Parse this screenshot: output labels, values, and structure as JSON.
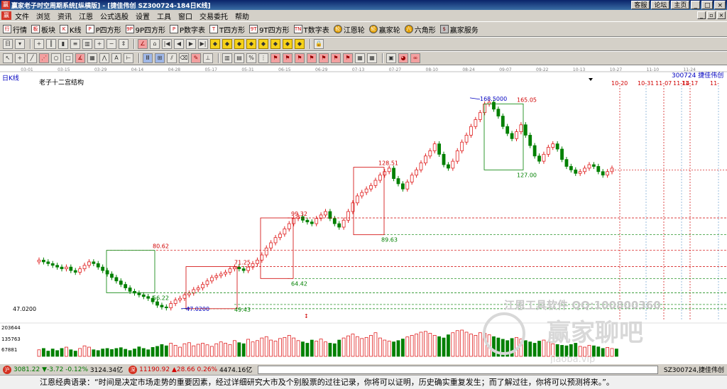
{
  "window": {
    "app_icon": "赢",
    "title": "赢家老子时空周期系统[纵横版] - [捷佳伟创  SZ300724-184日K线]",
    "top_links": [
      "客服",
      "论坛",
      "主页"
    ],
    "controls": [
      "minimize-icon",
      "maximize-icon",
      "close-icon"
    ]
  },
  "menu": {
    "items": [
      "文件",
      "浏览",
      "资讯",
      "江恩",
      "公式选股",
      "设置",
      "工具",
      "窗口",
      "交易委托",
      "帮助"
    ]
  },
  "toolbar1": {
    "tools": [
      {
        "icon": "行",
        "label": "行情"
      },
      {
        "icon": "板",
        "label": "板块"
      },
      {
        "icon": "K",
        "label": "K线"
      },
      {
        "icon": "P",
        "label": "P四方形"
      },
      {
        "icon": "9P",
        "label": "9P四方形"
      },
      {
        "icon": "P",
        "label": "P数字表"
      },
      {
        "icon": "T",
        "label": "T四方形"
      },
      {
        "icon": "9T",
        "label": "9T四方形"
      },
      {
        "icon": "TN",
        "label": "T数字表"
      },
      {
        "icon": "轮",
        "label": "江恩轮"
      },
      {
        "icon": "轮",
        "label": "赢家轮"
      },
      {
        "icon": "六",
        "label": "六角形"
      },
      {
        "icon": "$",
        "label": "赢家服务"
      }
    ]
  },
  "chart": {
    "period_label": "日K线",
    "indicator_label": "老子十二宫结构",
    "stock_label": "300724 捷佳伟创",
    "watermark_line1": "江恩工具软件  QQ:100800360",
    "watermark_line2": "赢家聊吧",
    "watermark_line3": "Jiaoba.vip",
    "colors": {
      "up": "#e02020",
      "down": "#008000",
      "grid": "#d00000",
      "box_green": "#008000",
      "box_red": "#e02020"
    }
  },
  "chart_data": {
    "type": "candlestick",
    "symbol": "SZ300724",
    "name": "捷佳伟创",
    "x_dates": [
      "03-01",
      "03-15",
      "03-29",
      "04-14",
      "04-28",
      "05-17",
      "05-31",
      "06-15",
      "06-29",
      "07-13",
      "07-27",
      "08-10",
      "08-24",
      "09-07",
      "09-22",
      "10-13",
      "10-27",
      "11-10",
      "11-24"
    ],
    "future_dates": [
      "10-20",
      "10-31",
      "11-07",
      "11-14",
      "11-17",
      "11-"
    ],
    "low_label": "47.0200",
    "volume_ticks": [
      "203644",
      "135763",
      "67881"
    ],
    "annotations": [
      {
        "text": "80.62",
        "color": "red"
      },
      {
        "text": "56.22",
        "color": "green"
      },
      {
        "text": "71.25",
        "color": "red"
      },
      {
        "text": "47.0200",
        "color": "blue"
      },
      {
        "text": "49.43",
        "color": "green"
      },
      {
        "text": "99.32",
        "color": "red"
      },
      {
        "text": "64.42",
        "color": "green"
      },
      {
        "text": "128.51",
        "color": "red"
      },
      {
        "text": "89.63",
        "color": "green"
      },
      {
        "text": "168.5000",
        "color": "blue"
      },
      {
        "text": "165.05",
        "color": "red"
      },
      {
        "text": "127.00",
        "color": "green"
      }
    ],
    "candles_close": [
      75,
      74,
      73,
      72,
      71,
      70,
      71,
      69,
      68,
      70,
      72,
      74,
      73,
      71,
      69,
      67,
      65,
      63,
      61,
      59,
      57,
      56,
      55,
      54,
      53,
      51,
      49,
      48,
      47.5,
      50,
      52,
      53,
      55,
      56,
      58,
      59,
      61,
      63,
      65,
      66,
      67,
      68,
      70,
      71,
      70,
      69,
      71,
      73,
      75,
      78,
      82,
      85,
      88,
      90,
      93,
      96,
      99,
      100,
      98,
      97,
      96,
      99,
      101,
      103,
      99,
      96,
      94,
      98,
      103,
      108,
      112,
      114,
      116,
      118,
      121,
      124,
      126,
      128,
      122,
      119,
      116,
      120,
      124,
      127,
      131,
      135,
      138,
      142,
      136,
      130,
      128,
      132,
      138,
      143,
      147,
      152,
      156,
      160,
      165,
      166,
      162,
      158,
      152,
      148,
      145,
      149,
      153,
      147,
      141,
      135,
      132,
      136,
      140,
      142,
      139,
      133,
      129,
      127,
      125,
      126,
      128,
      130,
      129,
      126,
      124,
      126,
      128
    ],
    "volume_ratio": [
      0.25,
      0.3,
      0.2,
      0.28,
      0.22,
      0.3,
      0.35,
      0.25,
      0.2,
      0.3,
      0.4,
      0.35,
      0.25,
      0.22,
      0.28,
      0.3,
      0.26,
      0.3,
      0.33,
      0.27,
      0.22,
      0.28,
      0.36,
      0.3,
      0.25,
      0.34,
      0.38,
      0.45,
      0.4,
      0.5,
      0.42,
      0.35,
      0.48,
      0.52,
      0.4,
      0.46,
      0.5,
      0.44,
      0.38,
      0.48,
      0.55,
      0.5,
      0.45,
      0.6,
      0.52,
      0.48,
      0.65,
      0.55,
      0.6,
      0.7,
      0.75,
      0.62,
      0.58,
      0.68,
      0.72,
      0.8,
      0.7,
      0.6,
      0.55,
      0.5,
      0.62,
      0.58,
      0.66,
      0.55,
      0.5,
      0.48,
      0.62,
      0.7,
      0.78,
      0.85,
      0.75,
      0.68,
      0.72,
      0.8,
      0.9,
      0.7,
      0.62,
      0.58,
      0.55,
      0.6,
      0.66,
      0.74,
      0.8,
      0.85,
      0.92,
      0.95,
      0.88,
      0.8,
      0.75,
      0.7,
      0.82,
      0.9,
      0.98,
      1.0,
      0.92,
      0.85,
      0.8,
      0.9,
      0.88,
      0.82,
      0.75,
      0.7,
      0.65,
      0.6,
      0.68,
      0.72,
      0.66,
      0.6,
      0.55,
      0.5,
      0.58,
      0.62,
      0.55,
      0.48,
      0.45,
      0.42,
      0.4,
      0.45,
      0.5,
      0.38,
      0.35,
      0.42,
      0.4,
      0.36,
      0.3,
      0.34,
      0.3,
      0.28
    ]
  },
  "status": {
    "index1_badge": "沪",
    "index1_val": "3081.22",
    "index1_chg": "▼-3.72",
    "index1_pct": "-0.12%",
    "index1_vol": "3124.34亿",
    "index2_badge": "深",
    "index2_val": "11190.92",
    "index2_chg": "▲28.66",
    "index2_pct": "0.26%",
    "index2_vol": "4474.16亿",
    "stock": "SZ300724,捷佳伟创"
  },
  "quote": {
    "text": "江恩经典语录：“时间是决定市场走势的重要因素，经过详细研究大市及个别股票的过往记录，你将可以证明，历史确实重复发生；而了解过往，你将可以预测将来。”。"
  }
}
